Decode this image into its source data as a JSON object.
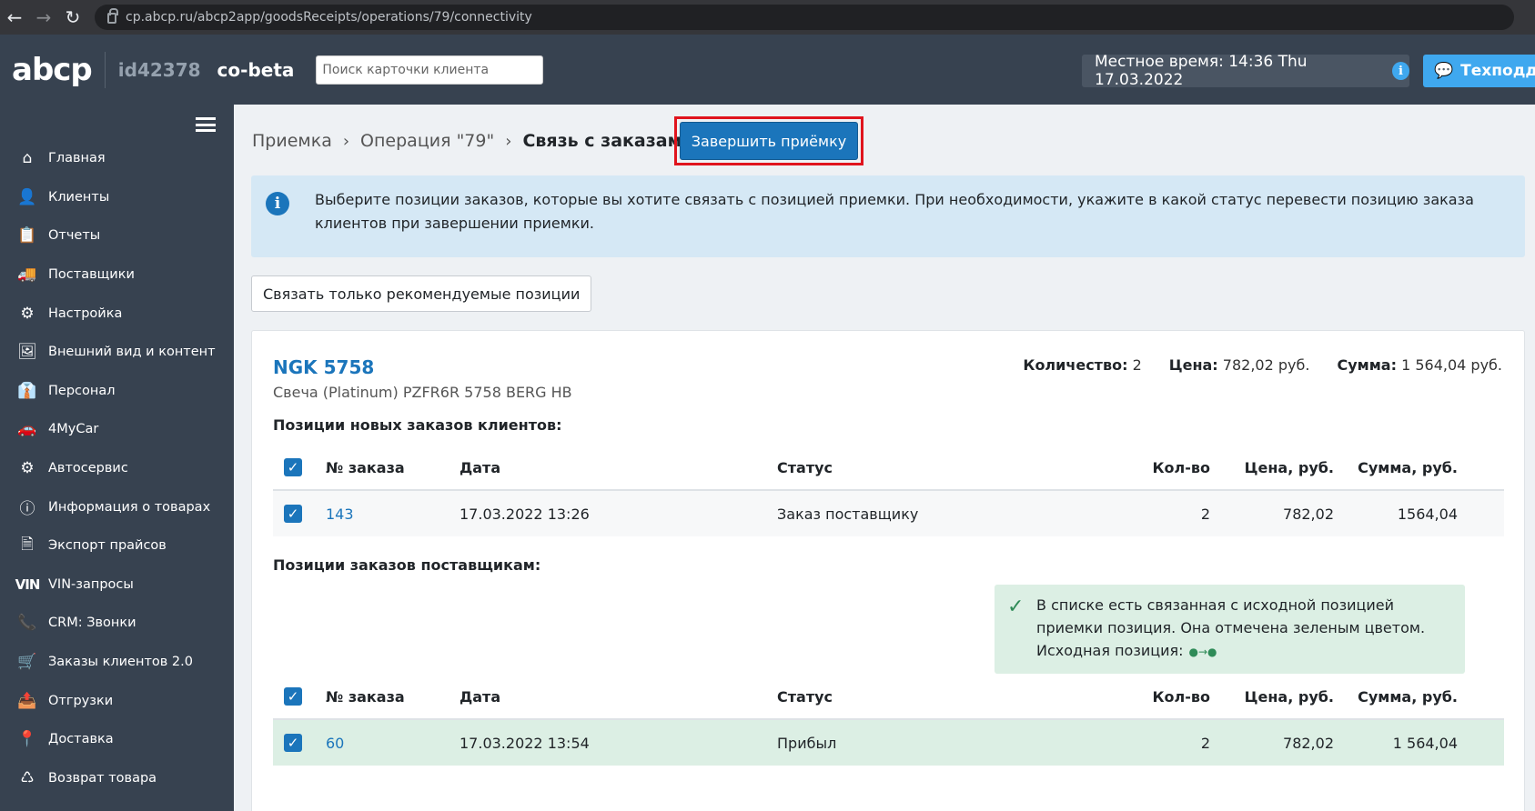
{
  "browser": {
    "url": "cp.abcp.ru/abcp2app/goodsReceipts/operations/79/connectivity"
  },
  "header": {
    "logo": "abcp",
    "client_id": "id42378",
    "client_name": "co-beta",
    "search_placeholder": "Поиск карточки клиента",
    "time_text": "Местное время: 14:36  Thu  17.03.2022",
    "support_label": "Техподдержка"
  },
  "sidebar": {
    "items": [
      {
        "label": "Главная",
        "icon": "home-icon",
        "glyph": "⌂"
      },
      {
        "label": "Клиенты",
        "icon": "users-icon",
        "glyph": "👤"
      },
      {
        "label": "Отчеты",
        "icon": "clipboard-icon",
        "glyph": "📋"
      },
      {
        "label": "Поставщики",
        "icon": "truck-icon",
        "glyph": "🚚"
      },
      {
        "label": "Настройка",
        "icon": "gear-icon",
        "glyph": "⚙"
      },
      {
        "label": "Внешний вид и контент",
        "icon": "image-icon",
        "glyph": "🖼"
      },
      {
        "label": "Персонал",
        "icon": "person-icon",
        "glyph": "👔"
      },
      {
        "label": "4MyCar",
        "icon": "car-icon",
        "glyph": "🚗"
      },
      {
        "label": "Автосервис",
        "icon": "cogs-icon",
        "glyph": "⚙"
      },
      {
        "label": "Информация о товарах",
        "icon": "info-icon",
        "glyph": "ⓘ"
      },
      {
        "label": "Экспорт прайсов",
        "icon": "excel-icon",
        "glyph": "🗎"
      },
      {
        "label": "VIN-запросы",
        "icon": "vin-icon",
        "glyph": "VIN"
      },
      {
        "label": "CRM: Звонки",
        "icon": "phone-icon",
        "glyph": "📞"
      },
      {
        "label": "Заказы клиентов 2.0",
        "icon": "cart-icon",
        "glyph": "🛒"
      },
      {
        "label": "Отгрузки",
        "icon": "shipment-icon",
        "glyph": "📤"
      },
      {
        "label": "Доставка",
        "icon": "location-icon",
        "glyph": "📍"
      },
      {
        "label": "Возврат товара",
        "icon": "return-icon",
        "glyph": "♺"
      }
    ]
  },
  "breadcrumb": {
    "items": [
      "Приемка",
      "Операция \"79\"",
      "Связь с заказами"
    ]
  },
  "finish_button_label": "Завершить приёмку",
  "info_alert": "Выберите позиции заказов, которые вы хотите связать с позицией приемки. При необходимости, укажите в какой статус перевести позицию заказа клиентов при завершении приемки.",
  "link_recommended_label": "Связать только рекомендуемые позиции",
  "product": {
    "name": "NGK 5758",
    "description": "Свеча (Platinum) PZFR6R 5758 BERG HB",
    "qty_label": "Количество:",
    "qty": "2",
    "price_label": "Цена:",
    "price": "782,02 руб.",
    "sum_label": "Сумма:",
    "sum": "1 564,04 руб."
  },
  "client_orders": {
    "title": "Позиции новых заказов клиентов:",
    "columns": [
      "№ заказа",
      "Дата",
      "Статус",
      "Кол-во",
      "Цена, руб.",
      "Сумма, руб."
    ],
    "rows": [
      {
        "num": "143",
        "date": "17.03.2022 13:26",
        "status": "Заказ поставщику",
        "qty": "2",
        "price": "782,02",
        "sum": "1564,04"
      }
    ]
  },
  "supplier_orders": {
    "title": "Позиции заказов поставщикам:",
    "success_alert": "В списке есть связанная с исходной позицией приемки позиция. Она отмечена зеленым цветом.",
    "source_label": "Исходная позиция:",
    "columns": [
      "№ заказа",
      "Дата",
      "Статус",
      "Кол-во",
      "Цена, руб.",
      "Сумма, руб."
    ],
    "rows": [
      {
        "num": "60",
        "date": "17.03.2022 13:54",
        "status": "Прибыл",
        "qty": "2",
        "price": "782,02",
        "sum": "1 564,04"
      }
    ]
  },
  "colors": {
    "accent": "#1b75bb",
    "sidebar": "#374250",
    "highlight_border": "#e0141d",
    "success_bg": "#dcefe4"
  }
}
